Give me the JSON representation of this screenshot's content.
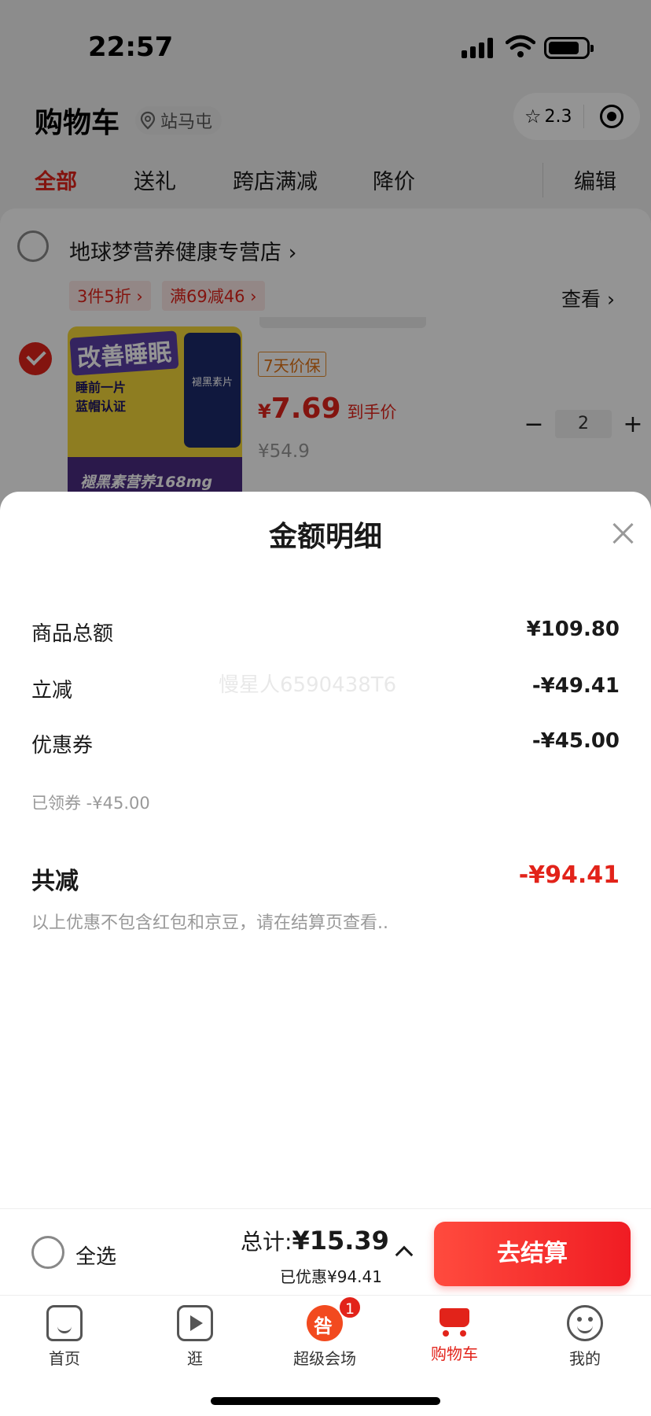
{
  "status_bar": {
    "time": "22:57"
  },
  "header": {
    "title": "购物车",
    "location": "站马屯",
    "capsule_rating": "2.3"
  },
  "tabs": [
    "全部",
    "送礼",
    "跨店满减",
    "降价",
    "编辑"
  ],
  "store": {
    "name": "地球梦营养健康专营店 ›",
    "promos": [
      "3件5折 ›",
      "满69减46 ›"
    ],
    "see_more": "查看 ›"
  },
  "product": {
    "image_title": "改善睡眠",
    "image_lines": [
      "睡前一片",
      "蓝帽认证"
    ],
    "image_bottle": "褪黑素片",
    "image_band": "褪黑素营养168mg",
    "price_protect": "7天价保",
    "final_price_symbol": "¥",
    "final_price": "7.69",
    "final_price_label": "到手价",
    "original_price": "¥54.9",
    "quantity": "2",
    "minus": "−",
    "plus": "+"
  },
  "sheet": {
    "title": "金额明细",
    "rows": [
      {
        "label": "商品总额",
        "value": "¥109.80"
      },
      {
        "label": "立减",
        "value": "-¥49.41"
      },
      {
        "label": "优惠券",
        "value": "-¥45.00"
      }
    ],
    "coupon_note": "已领券 -¥45.00",
    "total_label": "共减",
    "total_value": "-¥94.41",
    "disclaimer": "以上优惠不包含红包和京豆，请在结算页查看..",
    "watermark": "慢星人6590438T6"
  },
  "checkout": {
    "select_all": "全选",
    "total_label": "总计:",
    "total_value": "¥15.39",
    "saved": "已优惠¥94.41",
    "button": "去结算"
  },
  "tabbar": {
    "items": [
      {
        "label": "首页",
        "icon": "home-icon"
      },
      {
        "label": "逛",
        "icon": "video-icon"
      },
      {
        "label": "超级会场",
        "icon": "super-venue-icon"
      },
      {
        "label": "购物车",
        "icon": "cart-icon"
      },
      {
        "label": "我的",
        "icon": "profile-icon"
      }
    ],
    "badge": "1",
    "active_color": "#e2231a"
  }
}
